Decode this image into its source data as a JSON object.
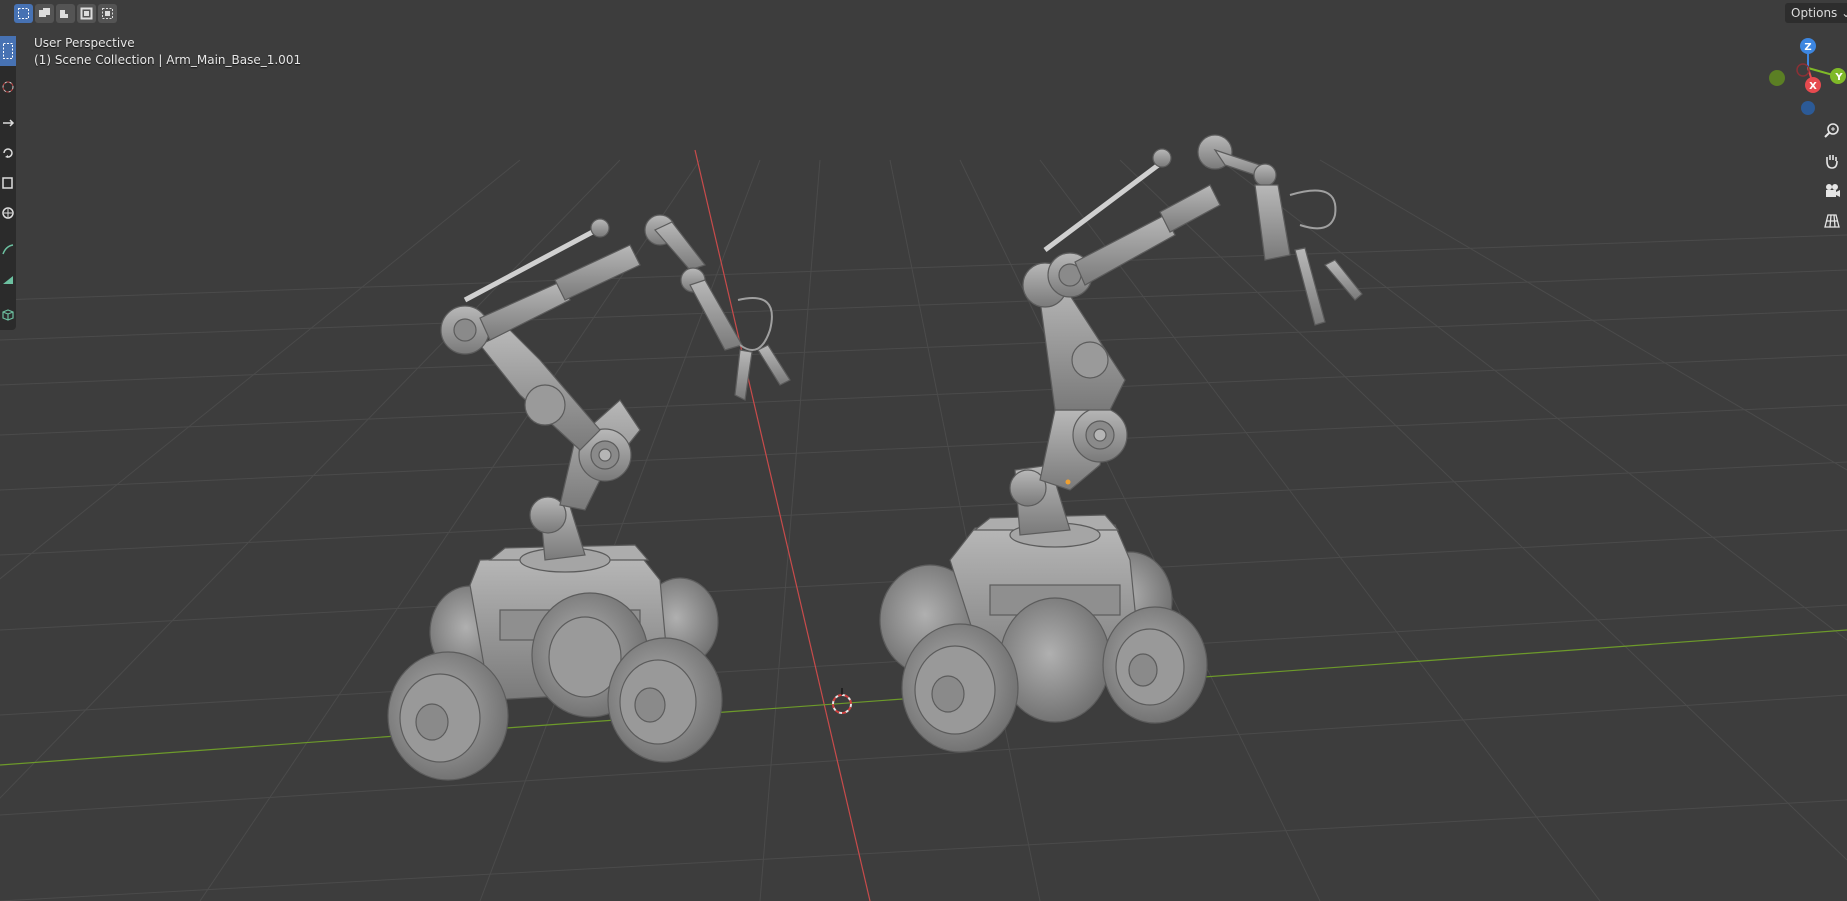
{
  "viewport": {
    "view_name": "User Perspective",
    "collection_label": "(1) Scene Collection | Arm_Main_Base_1.001"
  },
  "header": {
    "options_label": "Options",
    "options_chevron": "chevron-down-icon",
    "select_modes": [
      "select-set-icon",
      "select-extend-icon",
      "select-subtract-icon",
      "select-invert-icon",
      "select-intersect-icon"
    ]
  },
  "toolbar": {
    "tools": [
      "select-box-icon",
      "cursor-icon",
      "move-icon",
      "rotate-icon",
      "scale-icon",
      "transform-icon",
      "annotate-icon",
      "measure-icon",
      "add-cube-icon"
    ],
    "active_tool": "select-box-icon"
  },
  "gizmo": {
    "axis_labels": [
      "Z",
      "X",
      "Y"
    ],
    "colors": {
      "x": "#e64a4f",
      "y": "#7fb928",
      "z": "#3d86e0"
    }
  },
  "navigation": {
    "buttons": [
      "zoom-icon",
      "pan-hand-icon",
      "camera-icon",
      "grid-perspective-icon"
    ]
  },
  "scene": {
    "objects": [
      "robot-rover-left",
      "robot-rover-right"
    ],
    "colors": {
      "background": "#3d3d3d",
      "grid": "#4a4a4a",
      "x_axis": "#c84b4b",
      "y_axis": "#6d9a2a",
      "model": "#9a9a9a",
      "selected_accent": "#4772b3"
    }
  }
}
